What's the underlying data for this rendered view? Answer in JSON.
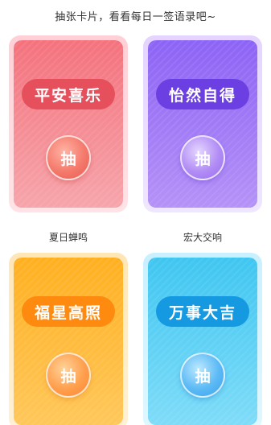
{
  "header": {
    "text": "抽张卡片，看看每日一签语录吧~"
  },
  "cards": [
    {
      "title": "平安喜乐",
      "button": "抽",
      "caption": "夏日蝉鸣",
      "color": "#f4727d"
    },
    {
      "title": "怡然自得",
      "button": "抽",
      "caption": "宏大交响",
      "color": "#8c63f5"
    },
    {
      "title": "福星高照",
      "button": "抽",
      "color": "#ffb020"
    },
    {
      "title": "万事大吉",
      "button": "抽",
      "color": "#3fc6f1"
    }
  ]
}
